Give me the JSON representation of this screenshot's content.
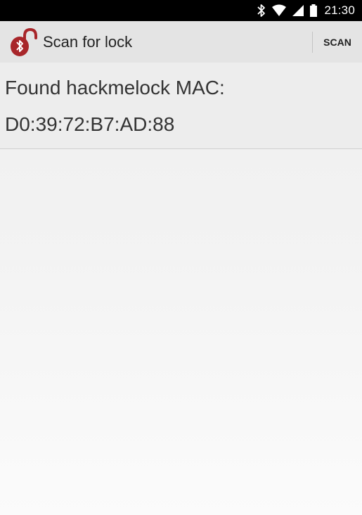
{
  "status_bar": {
    "time": "21:30",
    "icons": [
      "bluetooth-icon",
      "wifi-icon",
      "cell-signal-icon",
      "battery-icon"
    ]
  },
  "action_bar": {
    "title": "Scan for lock",
    "app_icon": "unlocked-padlock-bluetooth-icon",
    "scan_label": "SCAN"
  },
  "results": {
    "line1": "Found hackmelock MAC:",
    "line2": "D0:39:72:B7:AD:88"
  },
  "colors": {
    "status_bar_bg": "#000000",
    "action_bar_bg": "#e4e4e4",
    "app_icon_red": "#a8262a",
    "content_bg": "#eeeeee"
  }
}
